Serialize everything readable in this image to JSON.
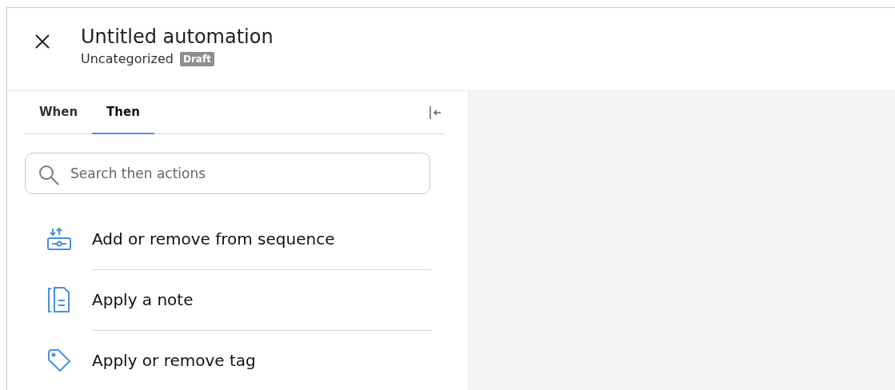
{
  "header": {
    "title": "Untitled automation",
    "category": "Uncategorized",
    "status": "Draft"
  },
  "tabs": [
    {
      "label": "When",
      "selected": false
    },
    {
      "label": "Then",
      "selected": true
    }
  ],
  "search": {
    "placeholder": "Search then actions"
  },
  "actions": [
    {
      "kind": "sequence",
      "label": "Add or remove from sequence"
    },
    {
      "kind": "note",
      "label": "Apply a note"
    },
    {
      "kind": "tag",
      "label": "Apply or remove tag"
    }
  ]
}
